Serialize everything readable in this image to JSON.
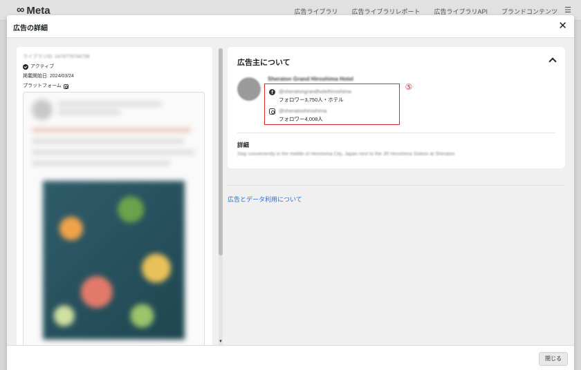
{
  "background_page": {
    "logo_text": "Meta",
    "nav_items": [
      "広告ライブラリ",
      "広告ライブラリレポート",
      "広告ライブラリAPI",
      "ブランドコンテンツ"
    ],
    "menu_icon": "hamburger-icon"
  },
  "modal": {
    "title": "広告の詳細",
    "close_icon": "close-icon",
    "footer_close_label": "閉じる"
  },
  "ad_preview": {
    "library_id": "ライブラリID: 1474779744736",
    "status": "アクティブ",
    "start_date": "掲載開始日: 2024/03/24",
    "platform_label": "プラットフォーム"
  },
  "advertiser": {
    "section_title": "広告主について",
    "name": "Sheraton Grand Hiroshima Hotel",
    "facebook": {
      "handle": "@sheratongrandhotelhiroshima",
      "meta": "フォロワー3,750人・ホテル"
    },
    "instagram": {
      "handle": "@sheratonhiroshima",
      "meta": "フォロワー4,008人"
    },
    "callout_number": "⑤",
    "details_title": "詳細",
    "details_text": "Stay conveniently in the middle of Hiroshima City, Japan next to the JR Hiroshima Station at Sheraton"
  },
  "links": {
    "ads_data_usage": "広告とデータ利用について"
  },
  "colors": {
    "highlight_red": "#d9262c",
    "link_blue": "#216fdb"
  }
}
